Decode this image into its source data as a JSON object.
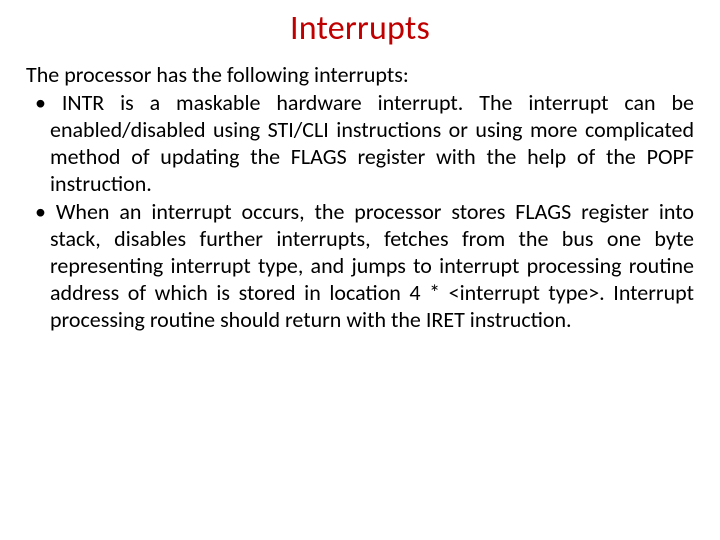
{
  "slide": {
    "title": "Interrupts",
    "intro": "The processor has the following interrupts:",
    "bullets": [
      "INTR is a maskable hardware interrupt. The interrupt can be enabled/disabled using STI/CLI instructions or using more complicated method of updating the FLAGS register with the help of the POPF instruction.",
      "When an interrupt occurs, the processor stores FLAGS register into stack, disables further interrupts, fetches from the bus one byte representing interrupt type, and jumps to interrupt processing routine address of which is stored in location 4 * <interrupt type>. Interrupt processing routine should return with the IRET instruction."
    ]
  }
}
